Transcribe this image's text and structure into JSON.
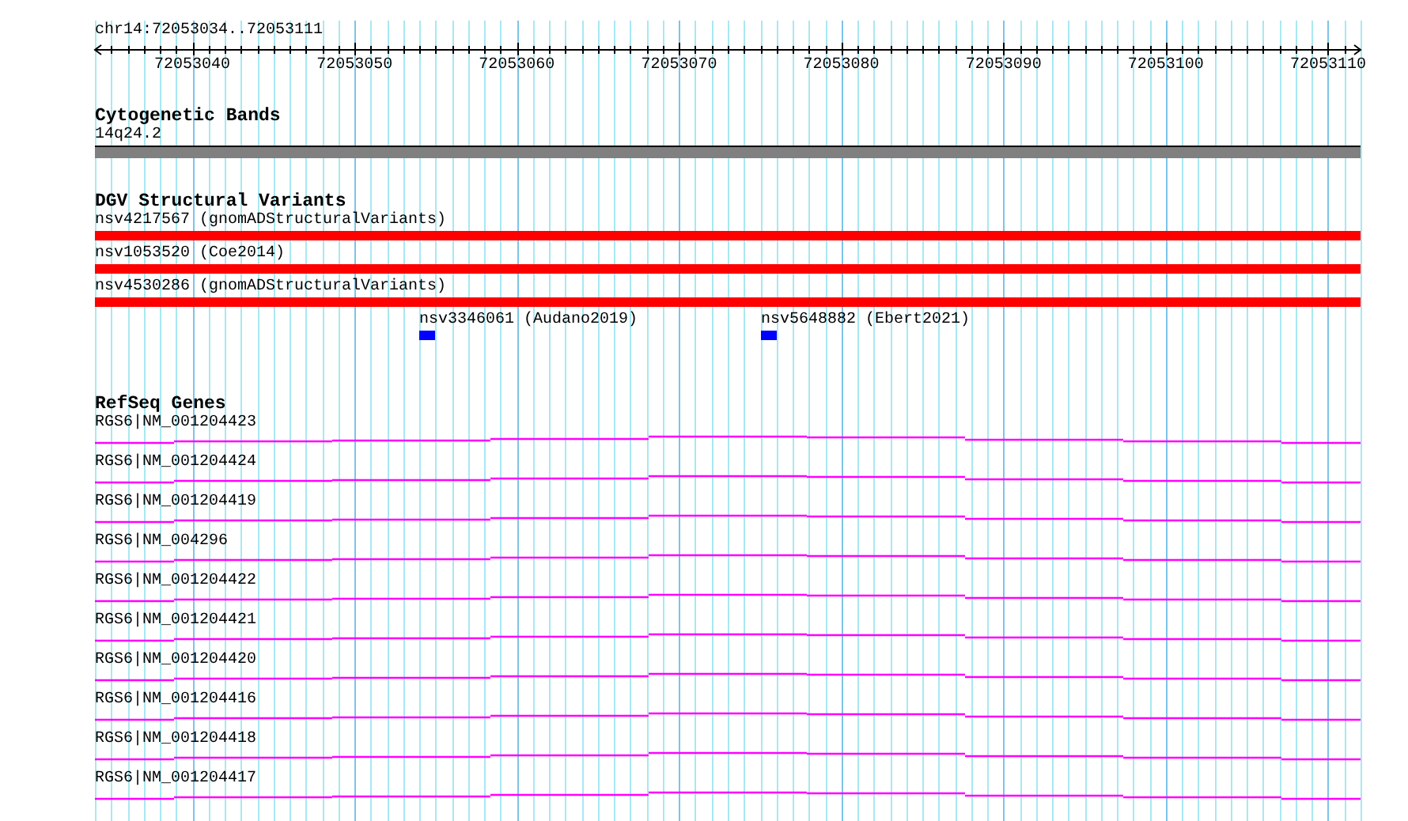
{
  "location": "chr14:72053034..72053111",
  "ruler": {
    "tick_labels": [
      "72053040",
      "72053050",
      "72053060",
      "72053070",
      "72053080",
      "72053090",
      "72053100",
      "72053110"
    ]
  },
  "tracks": [
    {
      "kind": "cytoband",
      "title": "Cytogenetic Bands",
      "features": [
        {
          "kind": "spanning",
          "label": "14q24.2",
          "color": "#808080"
        }
      ]
    },
    {
      "kind": "variants",
      "title": "DGV Structural Variants",
      "features": [
        {
          "kind": "spanning",
          "label": "nsv4217567 (gnomADStructuralVariants)",
          "color": "#ff0000"
        },
        {
          "kind": "spanning",
          "label": "nsv1053520 (Coe2014)",
          "color": "#ff0000"
        },
        {
          "kind": "spanning",
          "label": "nsv4530286 (gnomADStructuralVariants)",
          "color": "#ff0000"
        },
        {
          "kind": "block",
          "label": "nsv3346061 (Audano2019)",
          "color": "#0000ff"
        },
        {
          "kind": "block",
          "label": "nsv5648882 (Ebert2021)",
          "color": "#0000ff"
        }
      ]
    },
    {
      "kind": "genes",
      "title": "RefSeq Genes",
      "features": [
        {
          "kind": "intron",
          "label": "RGS6|NM_001204423",
          "color": "#ff00ff"
        },
        {
          "kind": "intron",
          "label": "RGS6|NM_001204424",
          "color": "#ff00ff"
        },
        {
          "kind": "intron",
          "label": "RGS6|NM_001204419",
          "color": "#ff00ff"
        },
        {
          "kind": "intron",
          "label": "RGS6|NM_004296",
          "color": "#ff00ff"
        },
        {
          "kind": "intron",
          "label": "RGS6|NM_001204422",
          "color": "#ff00ff"
        },
        {
          "kind": "intron",
          "label": "RGS6|NM_001204421",
          "color": "#ff00ff"
        },
        {
          "kind": "intron",
          "label": "RGS6|NM_001204420",
          "color": "#ff00ff"
        },
        {
          "kind": "intron",
          "label": "RGS6|NM_001204416",
          "color": "#ff00ff"
        },
        {
          "kind": "intron",
          "label": "RGS6|NM_001204418",
          "color": "#ff00ff"
        },
        {
          "kind": "intron",
          "label": "RGS6|NM_001204417",
          "color": "#ff00ff"
        }
      ]
    }
  ]
}
